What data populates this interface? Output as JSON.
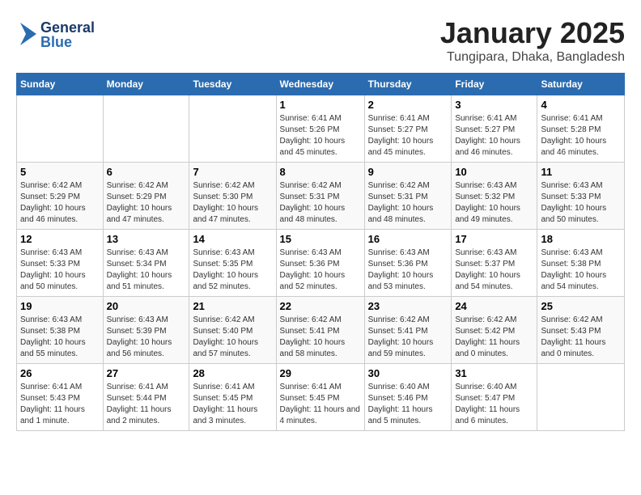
{
  "header": {
    "logo_general": "General",
    "logo_blue": "Blue",
    "month_title": "January 2025",
    "location": "Tungipara, Dhaka, Bangladesh"
  },
  "days_of_week": [
    "Sunday",
    "Monday",
    "Tuesday",
    "Wednesday",
    "Thursday",
    "Friday",
    "Saturday"
  ],
  "weeks": [
    {
      "days": [
        {
          "num": "",
          "sunrise": "",
          "sunset": "",
          "daylight": ""
        },
        {
          "num": "",
          "sunrise": "",
          "sunset": "",
          "daylight": ""
        },
        {
          "num": "",
          "sunrise": "",
          "sunset": "",
          "daylight": ""
        },
        {
          "num": "1",
          "sunrise": "Sunrise: 6:41 AM",
          "sunset": "Sunset: 5:26 PM",
          "daylight": "Daylight: 10 hours and 45 minutes."
        },
        {
          "num": "2",
          "sunrise": "Sunrise: 6:41 AM",
          "sunset": "Sunset: 5:27 PM",
          "daylight": "Daylight: 10 hours and 45 minutes."
        },
        {
          "num": "3",
          "sunrise": "Sunrise: 6:41 AM",
          "sunset": "Sunset: 5:27 PM",
          "daylight": "Daylight: 10 hours and 46 minutes."
        },
        {
          "num": "4",
          "sunrise": "Sunrise: 6:41 AM",
          "sunset": "Sunset: 5:28 PM",
          "daylight": "Daylight: 10 hours and 46 minutes."
        }
      ]
    },
    {
      "days": [
        {
          "num": "5",
          "sunrise": "Sunrise: 6:42 AM",
          "sunset": "Sunset: 5:29 PM",
          "daylight": "Daylight: 10 hours and 46 minutes."
        },
        {
          "num": "6",
          "sunrise": "Sunrise: 6:42 AM",
          "sunset": "Sunset: 5:29 PM",
          "daylight": "Daylight: 10 hours and 47 minutes."
        },
        {
          "num": "7",
          "sunrise": "Sunrise: 6:42 AM",
          "sunset": "Sunset: 5:30 PM",
          "daylight": "Daylight: 10 hours and 47 minutes."
        },
        {
          "num": "8",
          "sunrise": "Sunrise: 6:42 AM",
          "sunset": "Sunset: 5:31 PM",
          "daylight": "Daylight: 10 hours and 48 minutes."
        },
        {
          "num": "9",
          "sunrise": "Sunrise: 6:42 AM",
          "sunset": "Sunset: 5:31 PM",
          "daylight": "Daylight: 10 hours and 48 minutes."
        },
        {
          "num": "10",
          "sunrise": "Sunrise: 6:43 AM",
          "sunset": "Sunset: 5:32 PM",
          "daylight": "Daylight: 10 hours and 49 minutes."
        },
        {
          "num": "11",
          "sunrise": "Sunrise: 6:43 AM",
          "sunset": "Sunset: 5:33 PM",
          "daylight": "Daylight: 10 hours and 50 minutes."
        }
      ]
    },
    {
      "days": [
        {
          "num": "12",
          "sunrise": "Sunrise: 6:43 AM",
          "sunset": "Sunset: 5:33 PM",
          "daylight": "Daylight: 10 hours and 50 minutes."
        },
        {
          "num": "13",
          "sunrise": "Sunrise: 6:43 AM",
          "sunset": "Sunset: 5:34 PM",
          "daylight": "Daylight: 10 hours and 51 minutes."
        },
        {
          "num": "14",
          "sunrise": "Sunrise: 6:43 AM",
          "sunset": "Sunset: 5:35 PM",
          "daylight": "Daylight: 10 hours and 52 minutes."
        },
        {
          "num": "15",
          "sunrise": "Sunrise: 6:43 AM",
          "sunset": "Sunset: 5:36 PM",
          "daylight": "Daylight: 10 hours and 52 minutes."
        },
        {
          "num": "16",
          "sunrise": "Sunrise: 6:43 AM",
          "sunset": "Sunset: 5:36 PM",
          "daylight": "Daylight: 10 hours and 53 minutes."
        },
        {
          "num": "17",
          "sunrise": "Sunrise: 6:43 AM",
          "sunset": "Sunset: 5:37 PM",
          "daylight": "Daylight: 10 hours and 54 minutes."
        },
        {
          "num": "18",
          "sunrise": "Sunrise: 6:43 AM",
          "sunset": "Sunset: 5:38 PM",
          "daylight": "Daylight: 10 hours and 54 minutes."
        }
      ]
    },
    {
      "days": [
        {
          "num": "19",
          "sunrise": "Sunrise: 6:43 AM",
          "sunset": "Sunset: 5:38 PM",
          "daylight": "Daylight: 10 hours and 55 minutes."
        },
        {
          "num": "20",
          "sunrise": "Sunrise: 6:43 AM",
          "sunset": "Sunset: 5:39 PM",
          "daylight": "Daylight: 10 hours and 56 minutes."
        },
        {
          "num": "21",
          "sunrise": "Sunrise: 6:42 AM",
          "sunset": "Sunset: 5:40 PM",
          "daylight": "Daylight: 10 hours and 57 minutes."
        },
        {
          "num": "22",
          "sunrise": "Sunrise: 6:42 AM",
          "sunset": "Sunset: 5:41 PM",
          "daylight": "Daylight: 10 hours and 58 minutes."
        },
        {
          "num": "23",
          "sunrise": "Sunrise: 6:42 AM",
          "sunset": "Sunset: 5:41 PM",
          "daylight": "Daylight: 10 hours and 59 minutes."
        },
        {
          "num": "24",
          "sunrise": "Sunrise: 6:42 AM",
          "sunset": "Sunset: 5:42 PM",
          "daylight": "Daylight: 11 hours and 0 minutes."
        },
        {
          "num": "25",
          "sunrise": "Sunrise: 6:42 AM",
          "sunset": "Sunset: 5:43 PM",
          "daylight": "Daylight: 11 hours and 0 minutes."
        }
      ]
    },
    {
      "days": [
        {
          "num": "26",
          "sunrise": "Sunrise: 6:41 AM",
          "sunset": "Sunset: 5:43 PM",
          "daylight": "Daylight: 11 hours and 1 minute."
        },
        {
          "num": "27",
          "sunrise": "Sunrise: 6:41 AM",
          "sunset": "Sunset: 5:44 PM",
          "daylight": "Daylight: 11 hours and 2 minutes."
        },
        {
          "num": "28",
          "sunrise": "Sunrise: 6:41 AM",
          "sunset": "Sunset: 5:45 PM",
          "daylight": "Daylight: 11 hours and 3 minutes."
        },
        {
          "num": "29",
          "sunrise": "Sunrise: 6:41 AM",
          "sunset": "Sunset: 5:45 PM",
          "daylight": "Daylight: 11 hours and 4 minutes."
        },
        {
          "num": "30",
          "sunrise": "Sunrise: 6:40 AM",
          "sunset": "Sunset: 5:46 PM",
          "daylight": "Daylight: 11 hours and 5 minutes."
        },
        {
          "num": "31",
          "sunrise": "Sunrise: 6:40 AM",
          "sunset": "Sunset: 5:47 PM",
          "daylight": "Daylight: 11 hours and 6 minutes."
        },
        {
          "num": "",
          "sunrise": "",
          "sunset": "",
          "daylight": ""
        }
      ]
    }
  ]
}
